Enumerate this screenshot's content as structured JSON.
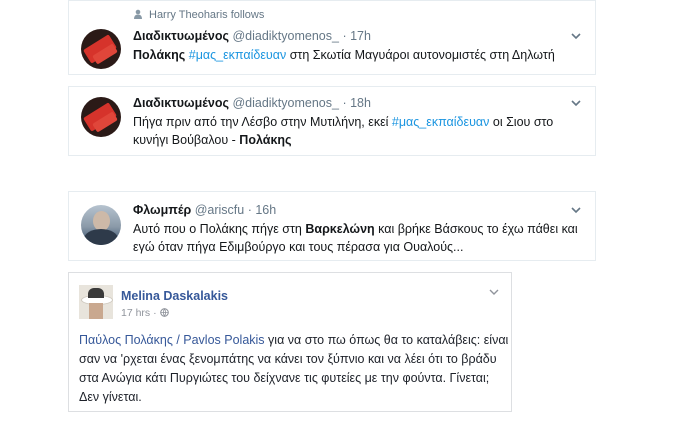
{
  "tweets": [
    {
      "context": "Harry Theoharis follows",
      "name": "Διαδικτυωμένος",
      "handle": "@diadiktyomenos_",
      "dot": "·",
      "time": "17h",
      "body": {
        "b1": "Πολάκης",
        "h1": "#μας_εκπαίδευαν",
        "t1": " στη Σκωτία Μαγυάροι αυτονομιστές στη Δηλωτή"
      }
    },
    {
      "name": "Διαδικτυωμένος",
      "handle": "@diadiktyomenos_",
      "dot": "·",
      "time": "18h",
      "body": {
        "t1": "Πήγα πριν από την Λέσβο στην Μυτιλήνη, εκεί ",
        "h1": "#μας_εκπαίδευαν",
        "t2": " οι Σιου στο κυνήγι Βούβαλου - ",
        "b1": "Πολάκης"
      }
    },
    {
      "name": "Φλωμπέρ",
      "handle": "@ariscfu",
      "dot": "·",
      "time": "16h",
      "body": {
        "t1": "Αυτό που ο Πολάκης πήγε στη ",
        "b1": "Βαρκελώνη",
        "t2": " και βρήκε Βάσκους το έχω πάθει και εγώ όταν πήγα Εδιμβούργο και τους πέρασα για Ουαλούς..."
      }
    }
  ],
  "facebook_post": {
    "name": "Melina Daskalakis",
    "time": "17 hrs",
    "dot": "·",
    "link": "Παύλος Πολάκης / Pavlos Polakis",
    "text": " για να στο πω όπως θα το καταλάβεις: είναι σαν να 'ρχεται ένας ξενομπάτης να κάνει τον ξύπνιο και να λέει ότι το βράδυ στα Ανώγια κάτι Πυργιώτες του δείχνανε τις φυτείες με την φούντα. Γίνεται; Δεν γίνεται."
  },
  "colors": {
    "twitter_link": "#1b95e0",
    "facebook_link": "#365899",
    "muted": "#657786"
  }
}
